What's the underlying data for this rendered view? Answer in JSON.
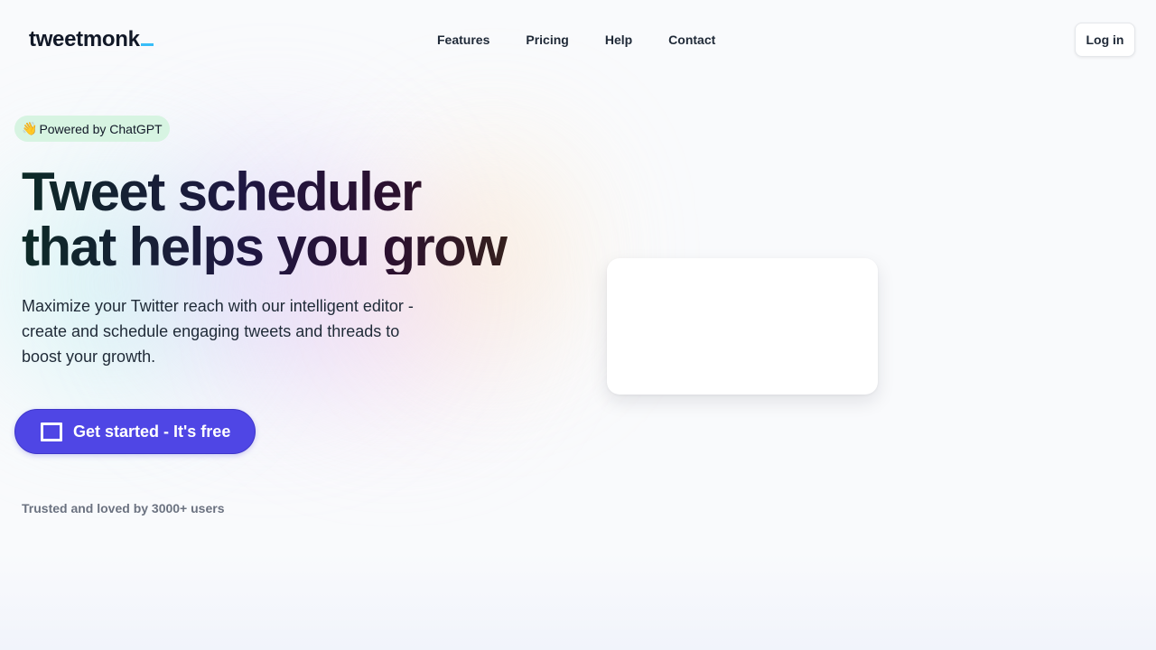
{
  "brand": {
    "name": "tweetmonk",
    "accent_color": "#38bdf8"
  },
  "nav": {
    "items": [
      {
        "label": "Features"
      },
      {
        "label": "Pricing"
      },
      {
        "label": "Help"
      },
      {
        "label": "Contact"
      }
    ],
    "login_label": "Log in"
  },
  "hero": {
    "badge": {
      "emoji": "👋",
      "text": "Powered by ChatGPT"
    },
    "headline": {
      "line1": "Tweet scheduler",
      "line2": "that helps you grow"
    },
    "subtitle": "Maximize your Twitter reach with our intelligent editor - create and schedule engaging tweets and threads to boost your growth.",
    "cta": {
      "label": "Get started - It's free",
      "icon": "square-icon",
      "color": "#4f46e5"
    },
    "trusted_text": "Trusted and loved by 3000+ users"
  }
}
